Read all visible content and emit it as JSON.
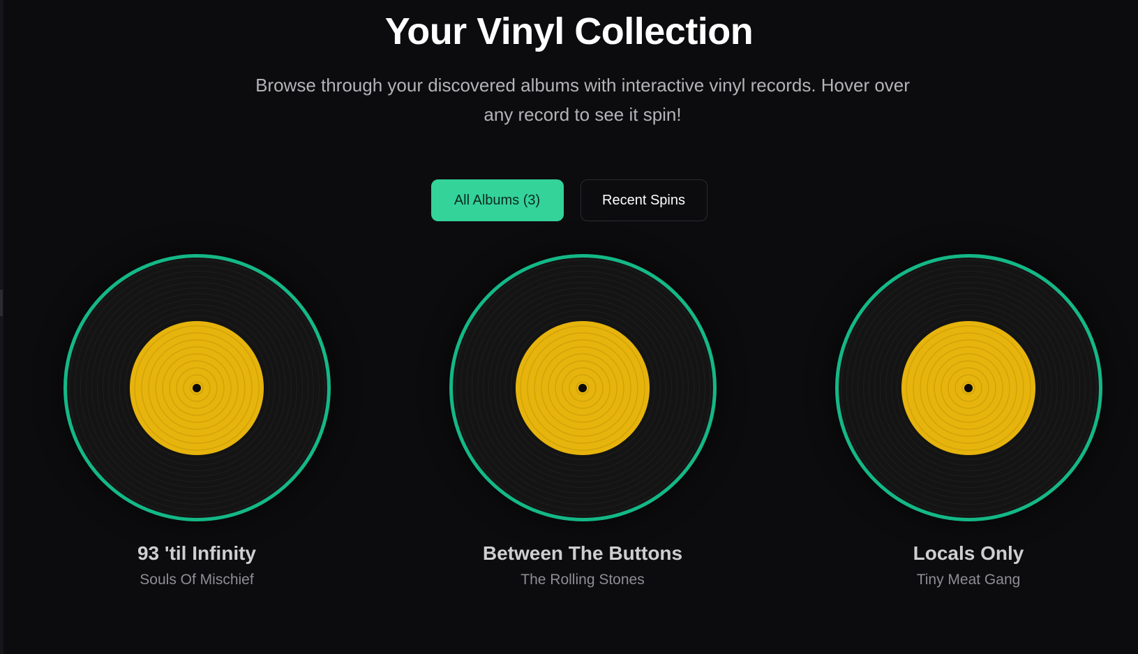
{
  "header": {
    "title": "Your Vinyl Collection",
    "subtitle": "Browse through your discovered albums with interactive vinyl records. Hover over any record to see it spin!"
  },
  "filters": {
    "all_albums_label": "All Albums (3)",
    "recent_spins_label": "Recent Spins",
    "active": "all_albums"
  },
  "albums": [
    {
      "title": "93 'til Infinity",
      "artist": "Souls Of Mischief"
    },
    {
      "title": "Between The Buttons",
      "artist": "The Rolling Stones"
    },
    {
      "title": "Locals Only",
      "artist": "Tiny Meat Gang"
    }
  ],
  "colors": {
    "accent": "#34d399",
    "vinyl_ring": "#14b886",
    "label": "#e6b40c",
    "background": "#0c0c0e"
  }
}
